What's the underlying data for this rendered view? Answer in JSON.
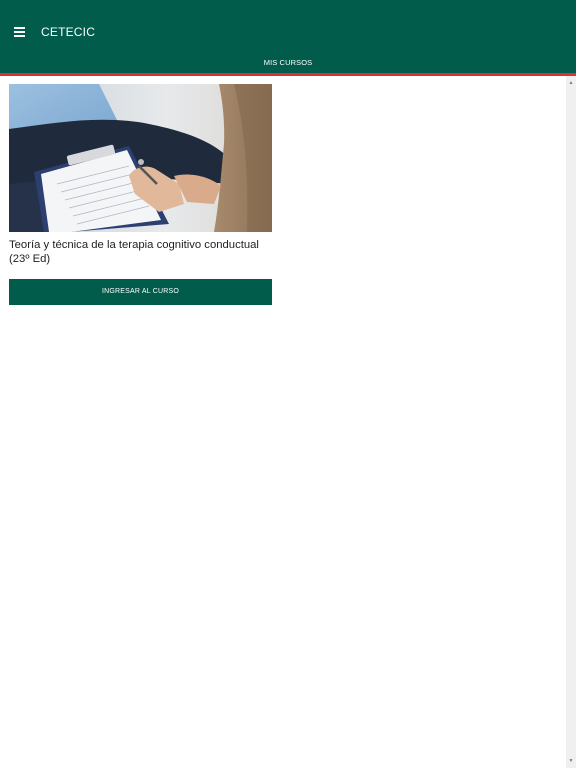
{
  "app": {
    "title": "CETECIC"
  },
  "nav": {
    "tab_label": "MIS CURSOS"
  },
  "course": {
    "title": "Teoría y técnica de la terapia cognitivo conductual (23º Ed)",
    "enter_label": "INGRESAR AL CURSO",
    "image": "course-cover-photo"
  },
  "colors": {
    "primary": "#015c4b",
    "accent": "#d7313a"
  },
  "icons": {
    "menu": "hamburger-menu-icon"
  }
}
